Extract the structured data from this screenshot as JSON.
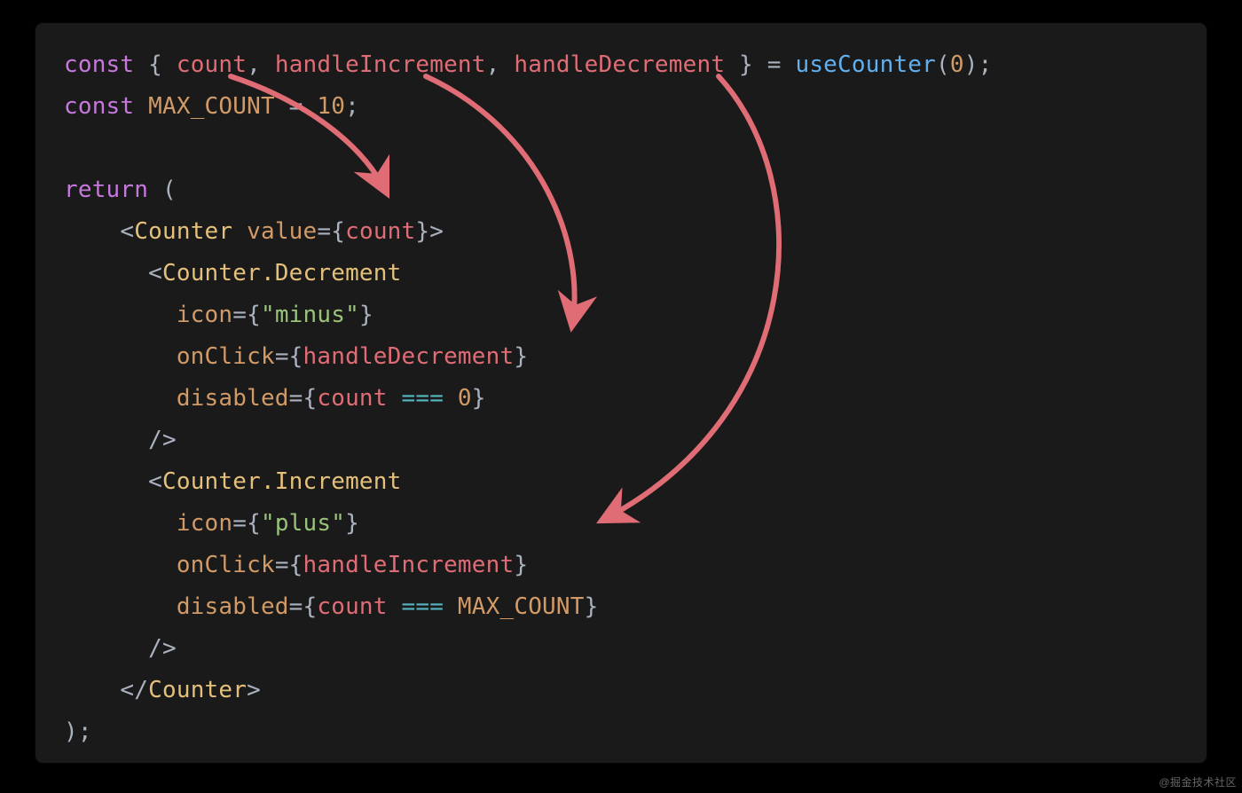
{
  "code": {
    "l1": {
      "const": "const",
      "ob": " { ",
      "count": "count",
      "c1": ", ",
      "hInc": "handleIncrement",
      "c2": ", ",
      "hDec": "handleDecrement",
      "cb": " } ",
      "eq": "= ",
      "useCounter": "useCounter",
      "op": "(",
      "zero": "0",
      "cp": ");"
    },
    "l2": {
      "const": "const",
      "sp": " ",
      "max": "MAX_COUNT",
      "eq": " = ",
      "ten": "10",
      "semi": ";"
    },
    "l4": {
      "return": "return",
      "p": " ("
    },
    "l5": {
      "ind": "    ",
      "lt": "<",
      "tag": "Counter",
      "sp": " ",
      "attr": "value",
      "eq": "=",
      "ob": "{",
      "val": "count",
      "cb": "}",
      "gt": ">"
    },
    "l6": {
      "ind": "      ",
      "lt": "<",
      "tag": "Counter.Decrement"
    },
    "l7": {
      "ind": "        ",
      "attr": "icon",
      "eq": "=",
      "ob": "{",
      "str": "\"minus\"",
      "cb": "}"
    },
    "l8": {
      "ind": "        ",
      "attr": "onClick",
      "eq": "=",
      "ob": "{",
      "val": "handleDecrement",
      "cb": "}"
    },
    "l9": {
      "ind": "        ",
      "attr": "disabled",
      "eq": "=",
      "ob": "{",
      "val": "count ",
      "op": "===",
      "sp": " ",
      "zero": "0",
      "cb": "}"
    },
    "l10": {
      "ind": "      ",
      "close": "/>"
    },
    "l11": {
      "ind": "      ",
      "lt": "<",
      "tag": "Counter.Increment"
    },
    "l12": {
      "ind": "        ",
      "attr": "icon",
      "eq": "=",
      "ob": "{",
      "str": "\"plus\"",
      "cb": "}"
    },
    "l13": {
      "ind": "        ",
      "attr": "onClick",
      "eq": "=",
      "ob": "{",
      "val": "handleIncrement",
      "cb": "}"
    },
    "l14": {
      "ind": "        ",
      "attr": "disabled",
      "eq": "=",
      "ob": "{",
      "val": "count ",
      "op": "===",
      "sp": " ",
      "max": "MAX_COUNT",
      "cb": "}"
    },
    "l15": {
      "ind": "      ",
      "close": "/>"
    },
    "l16": {
      "ind": "    ",
      "lt": "</",
      "tag": "Counter",
      "gt": ">"
    },
    "l17": {
      "p": ");"
    }
  },
  "watermark": "@掘金技术社区",
  "arrowColor": "#e06c75"
}
